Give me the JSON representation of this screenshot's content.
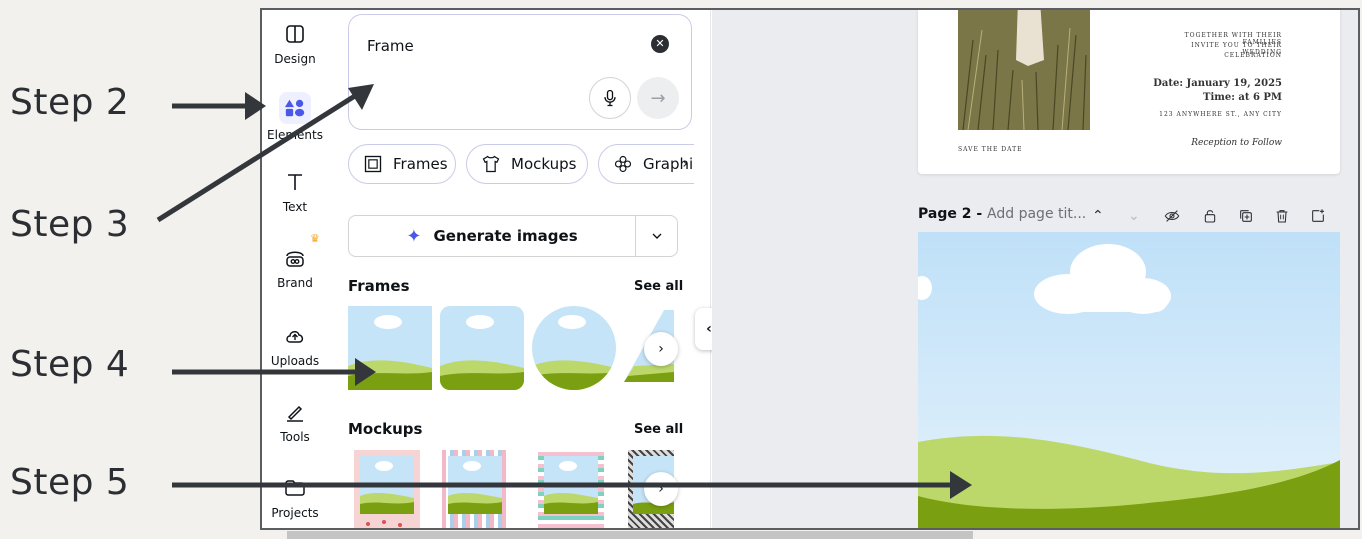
{
  "steps": {
    "s2": "Step 2",
    "s3": "Step 3",
    "s4": "Step 4",
    "s5": "Step 5"
  },
  "rail": {
    "design": "Design",
    "elements": "Elements",
    "text": "Text",
    "brand": "Brand",
    "uploads": "Uploads",
    "tools": "Tools",
    "projects": "Projects"
  },
  "search": {
    "value": "Frame"
  },
  "chips": {
    "frames": "Frames",
    "mockups": "Mockups",
    "graphics": "Graphic"
  },
  "generate": {
    "label": "Generate images"
  },
  "sections": {
    "frames_title": "Frames",
    "mockups_title": "Mockups",
    "see_all": "See all"
  },
  "invite": {
    "line1": "TOGETHER WITH THEIR FAMILIES",
    "line2": "INVITE YOU TO THEIR WEDDING",
    "line3": "CELEBRATION",
    "date": "Date: January 19, 2025",
    "time": "Time: at 6 PM",
    "address": "123 ANYWHERE ST., ANY CITY",
    "save": "SAVE THE DATE",
    "reception": "Reception to Follow"
  },
  "page_bar": {
    "name": "Page 2 - ",
    "title": "Add page tit..."
  },
  "icons": {
    "design": "layout-icon",
    "elements": "shapes-icon",
    "text": "text-icon",
    "brand": "brand-icon",
    "uploads": "cloud-upload-icon",
    "tools": "pen-icon",
    "projects": "folder-icon"
  },
  "colors": {
    "accent": "#4a58e8",
    "arrow": "#33373b",
    "sky": "#bfe0f8",
    "grass": "#7a9f10"
  }
}
